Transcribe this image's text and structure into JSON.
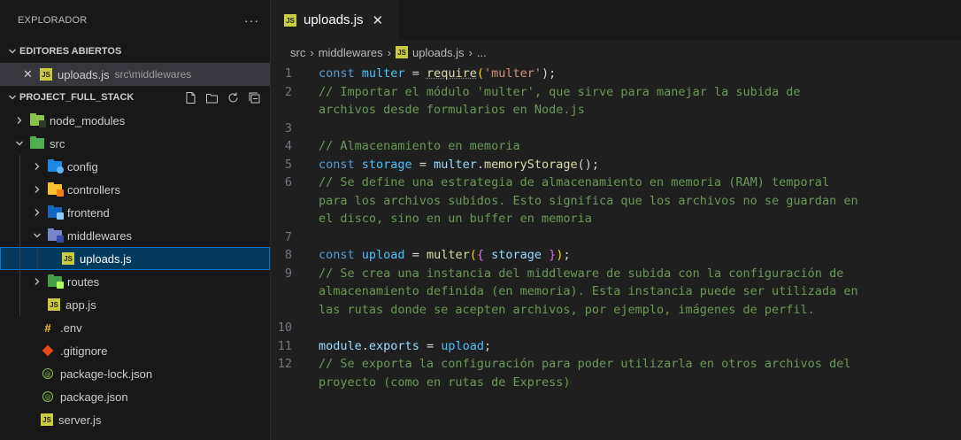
{
  "explorer": {
    "title": "EXPLORADOR",
    "more": "···",
    "open_editors": {
      "label": "EDITORES ABIERTOS",
      "items": [
        {
          "name": "uploads.js",
          "path": "src\\middlewares"
        }
      ]
    },
    "project": {
      "label": "PROJECT_FULL_STACK",
      "tree": {
        "node_modules": "node_modules",
        "src": "src",
        "config": "config",
        "controllers": "controllers",
        "frontend": "frontend",
        "middlewares": "middlewares",
        "uploads": "uploads.js",
        "routes": "routes",
        "app": "app.js",
        "env": ".env",
        "gitignore": ".gitignore",
        "package_lock": "package-lock.json",
        "package_json": "package.json",
        "server": "server.js"
      }
    }
  },
  "tab": {
    "label": "uploads.js",
    "close": "✕"
  },
  "breadcrumb": {
    "src": "src",
    "middlewares": "middlewares",
    "file": "uploads.js",
    "tail": "..."
  },
  "code": {
    "l1": {
      "kw": "const ",
      "name": "multer",
      "eq": " = ",
      "fn": "require",
      "open": "(",
      "str": "'multer'",
      "close": ");"
    },
    "l2a": "// Importar el módulo 'multer', que sirve para manejar la subida de",
    "l2b": "archivos desde formularios en Node.js",
    "l4": "// Almacenamiento en memoria",
    "l5": {
      "kw": "const ",
      "name": "storage",
      "eq": " = ",
      "obj": "multer",
      "dot": ".",
      "fn": "memoryStorage",
      "call": "();"
    },
    "l6a": "// Se define una estrategia de almacenamiento en memoria (RAM) temporal",
    "l6b": "para los archivos subidos. Esto significa que los archivos no se guardan en",
    "l6c": "el disco, sino en un buffer en memoria",
    "l8": {
      "kw": "const ",
      "name": "upload",
      "eq": " = ",
      "fn": "multer",
      "open": "(",
      "brace_open": "{",
      "arg": " storage ",
      "brace_close": "}",
      "close": ")",
      "semi": ";"
    },
    "l9a": "// Se crea una instancia del middleware de subida con la configuración de",
    "l9b": "almacenamiento definida (en memoria). Esta instancia puede ser utilizada en",
    "l9c": "las rutas donde se acepten archivos, por ejemplo, imágenes de perfil.",
    "l11": {
      "obj": "module",
      "dot": ".",
      "prop": "exports",
      "eq": " = ",
      "val": "upload",
      "semi": ";"
    },
    "l12a": "// Se exporta la configuración para poder utilizarla en otros archivos del",
    "l12b": "proyecto (como en rutas de Express)"
  },
  "line_numbers": [
    "1",
    "2",
    "",
    "3",
    "4",
    "5",
    "6",
    "",
    "",
    "7",
    "8",
    "9",
    "",
    "",
    "10",
    "11",
    "12",
    ""
  ],
  "colors": {
    "accent": "#0078d4",
    "js": "#cbcb41",
    "comment": "#6a9955",
    "keyword": "#569cd6"
  }
}
